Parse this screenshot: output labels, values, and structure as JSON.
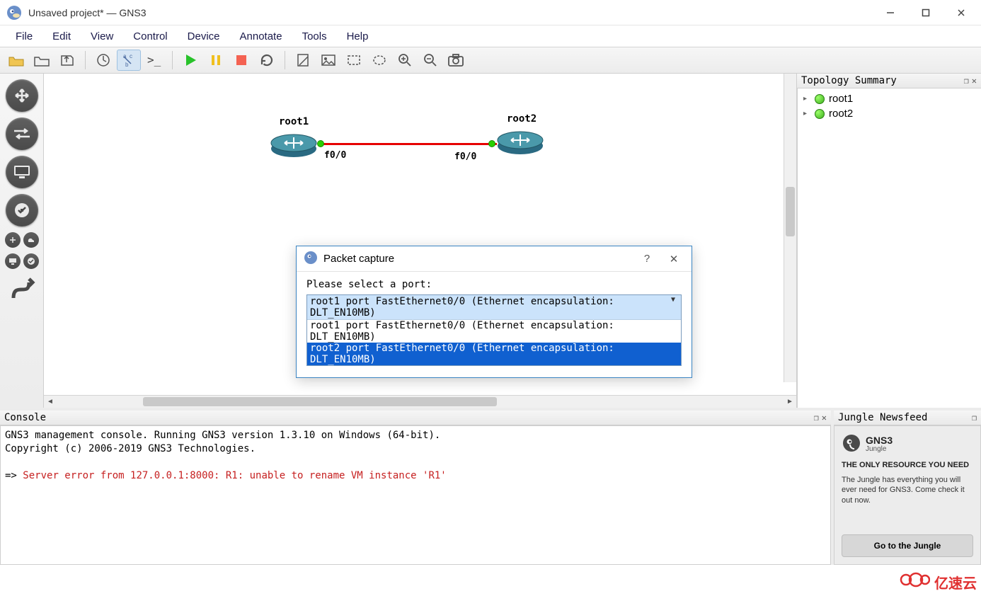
{
  "window": {
    "title": "Unsaved project* — GNS3"
  },
  "menu": [
    "File",
    "Edit",
    "View",
    "Control",
    "Device",
    "Annotate",
    "Tools",
    "Help"
  ],
  "topology": {
    "title": "Topology Summary",
    "nodes": [
      {
        "name": "root1",
        "port_label": "f0/0"
      },
      {
        "name": "root2",
        "port_label": "f0/0"
      }
    ]
  },
  "dialog": {
    "title": "Packet capture",
    "prompt": "Please select a port:",
    "selected": "root1 port FastEthernet0/0 (Ethernet encapsulation: DLT_EN10MB)",
    "options": [
      "root1 port FastEthernet0/0 (Ethernet encapsulation: DLT_EN10MB)",
      "root2 port FastEthernet0/0 (Ethernet encapsulation: DLT_EN10MB)"
    ]
  },
  "console": {
    "title": "Console",
    "line1": "GNS3 management console. Running GNS3 version 1.3.10 on Windows (64-bit).",
    "line2": "Copyright (c) 2006-2019 GNS3 Technologies.",
    "prompt": "=> ",
    "error": "Server error from 127.0.0.1:8000: R1: unable to rename VM instance 'R1'"
  },
  "newsfeed": {
    "title": "Jungle Newsfeed",
    "brand": "GNS3",
    "brand_sub": "Jungle",
    "headline": "THE ONLY RESOURCE YOU NEED",
    "desc": "The Jungle has everything you will ever need for GNS3. Come check it out now.",
    "button": "Go to the Jungle"
  },
  "watermark": "亿速云"
}
